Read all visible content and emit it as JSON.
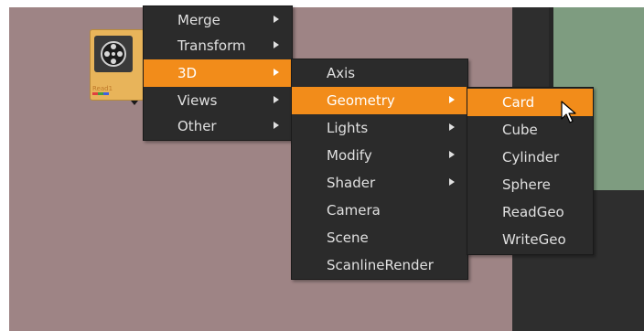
{
  "colors": {
    "canvas": "#9e8485",
    "menu_bg": "#2b2b2b",
    "menu_text": "#e0e0e0",
    "highlight": "#f28c1a",
    "viewer": "#7e9c80",
    "node": "#e8b45a"
  },
  "node": {
    "label": "Read1",
    "icon": "film-reel-icon"
  },
  "menu_main": {
    "items": [
      {
        "label": "Merge",
        "submenu": true
      },
      {
        "label": "Transform",
        "submenu": true
      },
      {
        "label": "3D",
        "submenu": true,
        "active": true
      },
      {
        "label": "Views",
        "submenu": true
      },
      {
        "label": "Other",
        "submenu": true
      }
    ]
  },
  "menu_3d": {
    "items": [
      {
        "label": "Axis"
      },
      {
        "label": "Geometry",
        "submenu": true,
        "active": true
      },
      {
        "label": "Lights",
        "submenu": true
      },
      {
        "label": "Modify",
        "submenu": true
      },
      {
        "label": "Shader",
        "submenu": true
      },
      {
        "label": "Camera"
      },
      {
        "label": "Scene"
      },
      {
        "label": "ScanlineRender"
      }
    ]
  },
  "menu_geometry": {
    "items": [
      {
        "label": "Card",
        "active": true
      },
      {
        "label": "Cube"
      },
      {
        "label": "Cylinder"
      },
      {
        "label": "Sphere"
      },
      {
        "label": "ReadGeo"
      },
      {
        "label": "WriteGeo"
      }
    ]
  },
  "cursor": "arrow-cursor-icon"
}
